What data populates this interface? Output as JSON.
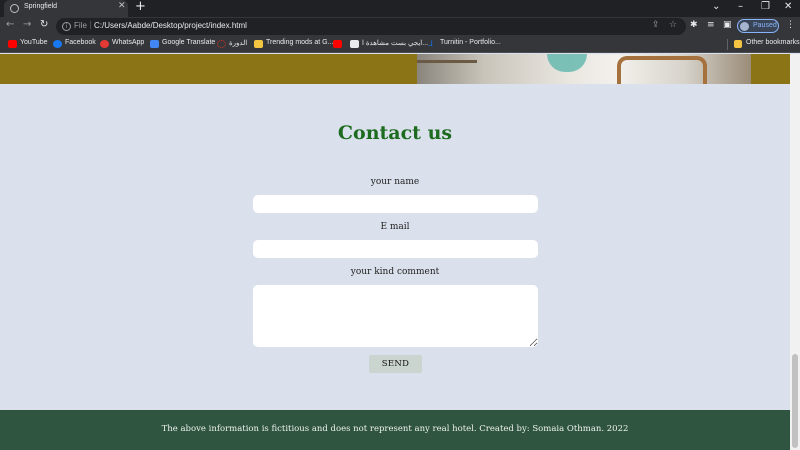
{
  "browser": {
    "tab_title": "Springfield",
    "scheme_label": "File",
    "url": "C:/Users/Aabde/Desktop/project/index.html",
    "profile_status": "Paused",
    "new_tab_glyph": "+",
    "close_glyph": "✕"
  },
  "bookmarks": [
    {
      "label": "YouTube",
      "icon": "youtube-icon",
      "color": "#ff0000"
    },
    {
      "label": "Facebook",
      "icon": "facebook-icon",
      "color": "#1877f2"
    },
    {
      "label": "WhatsApp",
      "icon": "whatsapp-icon",
      "color": "#e53935"
    },
    {
      "label": "Google Translate",
      "icon": "google-translate-icon",
      "color": "#4285f4"
    },
    {
      "label": "الدورة",
      "icon": "course-icon",
      "color": "#d93025"
    },
    {
      "label": "Trending mods at G...",
      "icon": "mods-icon",
      "color": "#f4c542"
    },
    {
      "label": "",
      "icon": "youtube-icon",
      "color": "#ff0000"
    },
    {
      "label": "ايجي بست مشاهدة ا...",
      "icon": "page-icon",
      "color": "#e8eaed"
    },
    {
      "label": "Turnitin - Portfolio...",
      "icon": "turnitin-icon",
      "color": "#1a73e8"
    }
  ],
  "other_bookmarks": "Other bookmarks",
  "contact": {
    "title": "Contact us",
    "name_label": "your name",
    "email_label": "E mail",
    "comment_label": "your kind comment",
    "send_label": "SEND"
  },
  "footer": {
    "text": "The above information is fictitious and does not represent any real hotel. Created by: Somaia Othman. 2022"
  },
  "colors": {
    "page_bg": "#dbe1ec",
    "title_green": "#1c6b1e",
    "footer_bg": "#2f5540",
    "hero_gold": "#8b7416"
  }
}
